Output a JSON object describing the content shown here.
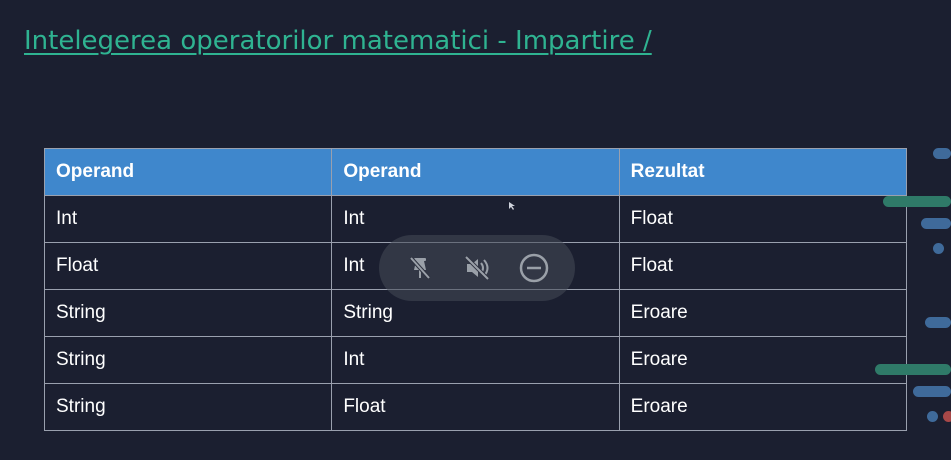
{
  "slide": {
    "title": "Intelegerea operatorilor matematici - Impartire /"
  },
  "table": {
    "headers": [
      "Operand",
      "Operand",
      "Rezultat"
    ],
    "rows": [
      [
        "Int",
        "Int",
        "Float"
      ],
      [
        "Float",
        "Int",
        "Float"
      ],
      [
        "String",
        "String",
        "Eroare"
      ],
      [
        "String",
        "Int",
        "Eroare"
      ],
      [
        "String",
        "Float",
        "Eroare"
      ]
    ]
  },
  "overlay_controls": {
    "icons": [
      "pin-off-icon",
      "speaker-muted-icon",
      "minus-circle-icon"
    ]
  },
  "colors": {
    "background": "#1b1f30",
    "title": "#2fb391",
    "header": "#3f87cc",
    "text": "#ffffff",
    "border": "#9aa0ae"
  }
}
